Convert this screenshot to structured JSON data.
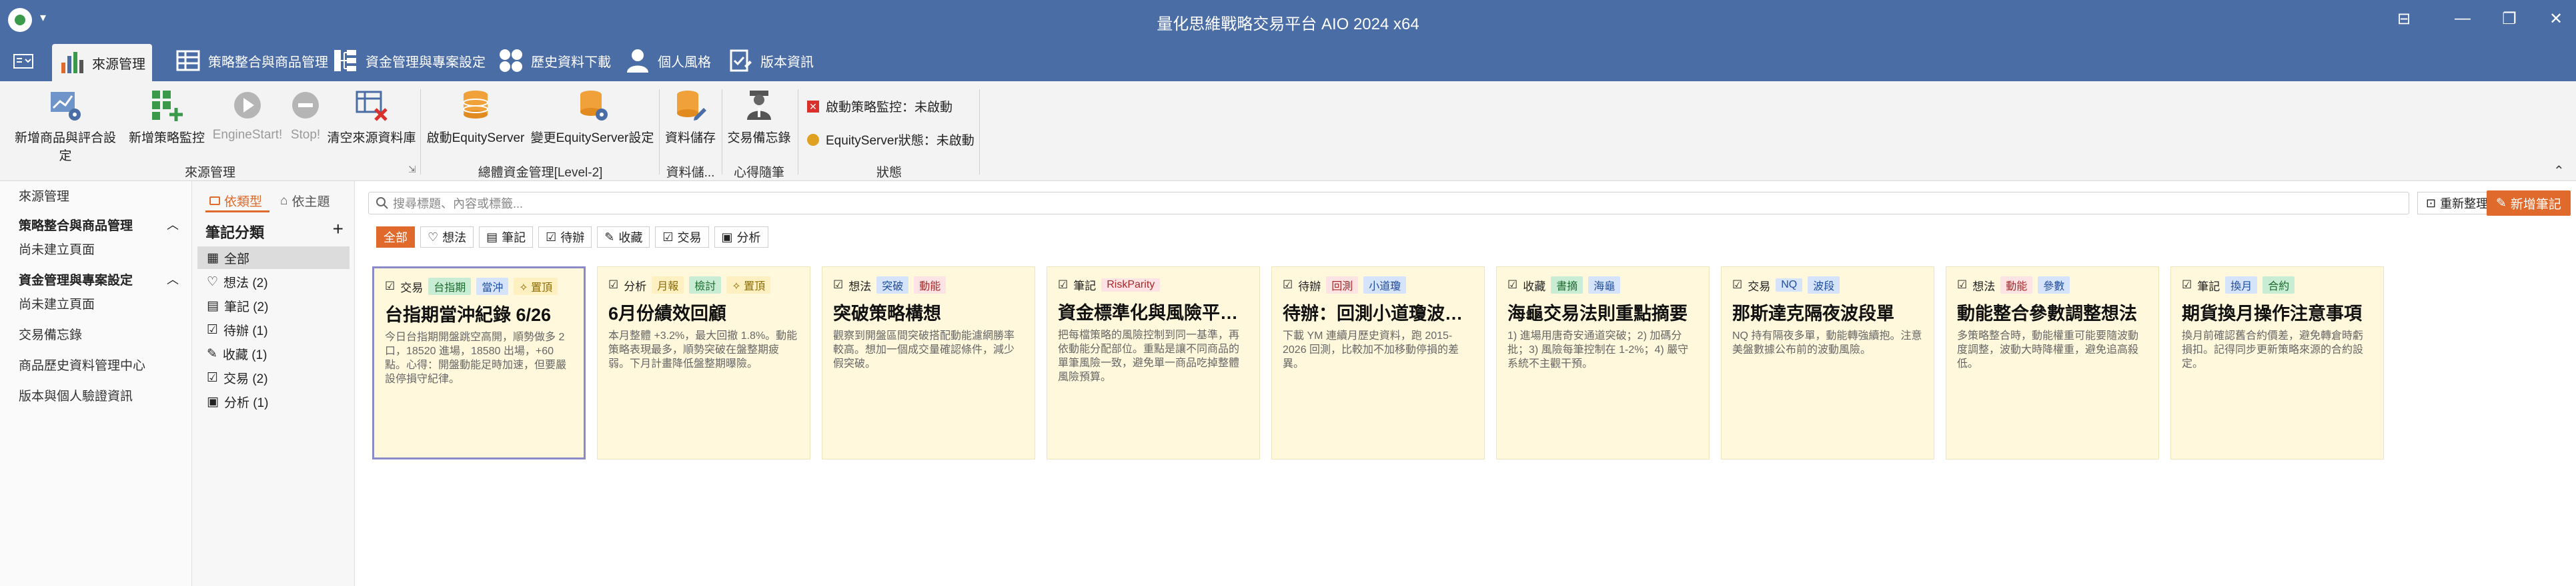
{
  "window": {
    "title": "量化思維戰略交易平台 AIO 2024 x64"
  },
  "tabs": [
    {
      "label": "來源管理",
      "icon": "bar-chart-icon"
    },
    {
      "label": "策略整合與商品管理",
      "icon": "grid-icon"
    },
    {
      "label": "資金管理與專案設定",
      "icon": "tree-icon"
    },
    {
      "label": "歷史資料下載",
      "icon": "dots-icon"
    },
    {
      "label": "個人風格",
      "icon": "person-icon"
    },
    {
      "label": "版本資訊",
      "icon": "clipboard-icon"
    }
  ],
  "ribbon": {
    "buttons": [
      {
        "label": "新增商品與評合設定",
        "icon": "gear-chart-icon"
      },
      {
        "label": "新增策略監控",
        "icon": "grid-add-icon"
      },
      {
        "label": "EngineStart!",
        "icon": "play-icon"
      },
      {
        "label": "Stop!",
        "icon": "minus-icon"
      },
      {
        "label": "清空來源資料庫",
        "icon": "clear-grid-icon"
      },
      {
        "label": "啟動EquityServer",
        "icon": "database-icon"
      },
      {
        "label": "變更EquityServer設定",
        "icon": "database-gear-icon"
      },
      {
        "label": "資料儲存",
        "icon": "database-edit-icon"
      },
      {
        "label": "交易備忘錄",
        "icon": "trader-icon"
      }
    ],
    "groups": [
      "來源管理",
      "總體資金管理[Level-2]",
      "資料儲...",
      "心得隨筆",
      "狀態"
    ],
    "status": {
      "monitor": "啟動策略監控：未啟動",
      "equity": "EquityServer狀態：未啟動"
    }
  },
  "leftnav": {
    "top": "來源管理",
    "sections": [
      {
        "head": "策略整合與商品管理",
        "items": [
          "尚未建立頁面"
        ]
      },
      {
        "head": "資金管理與專案設定",
        "items": [
          "尚未建立頁面",
          "交易備忘錄",
          "商品歷史資料管理中心",
          "版本與個人驗證資訊"
        ]
      }
    ]
  },
  "catpanel": {
    "tab_type": "依類型",
    "tab_theme": "依主題",
    "title": "筆記分類",
    "add": "+",
    "items": [
      {
        "icon": "grid-icon",
        "label": "全部"
      },
      {
        "icon": "bulb-icon",
        "label": "想法 (2)"
      },
      {
        "icon": "note-icon",
        "label": "筆記 (2)"
      },
      {
        "icon": "check-icon",
        "label": "待辦 (1)"
      },
      {
        "icon": "pin-icon",
        "label": "收藏 (1)"
      },
      {
        "icon": "chart-icon",
        "label": "交易 (2)"
      },
      {
        "icon": "chart-bar-icon",
        "label": "分析 (1)"
      }
    ]
  },
  "main": {
    "search_placeholder": "搜尋標題、內容或標籤...",
    "refresh": "重新整理",
    "new_note": "新增筆記",
    "filters": [
      "全部",
      "想法",
      "筆記",
      "待辦",
      "收藏",
      "交易",
      "分析"
    ],
    "cards": [
      {
        "type": "交易",
        "tags": [
          {
            "t": "台指期",
            "c": 0
          },
          {
            "t": "當沖",
            "c": 1
          },
          {
            "t": "✧ 置頂",
            "c": 3
          }
        ],
        "title": "台指期當沖紀錄 6/26",
        "body": "今日台指期開盤跳空高開，順勢做多 2 口，18520 進場，18580 出場，+60 點。心得：開盤動能足時加速，但要嚴設停損守紀律。"
      },
      {
        "type": "分析",
        "tags": [
          {
            "t": "月報",
            "c": 3
          },
          {
            "t": "檢討",
            "c": 0
          },
          {
            "t": "✧ 置頂",
            "c": 3
          }
        ],
        "title": "6月份績效回顧",
        "body": "本月整體 +3.2%，最大回撤 1.8%。動能策略表現最多，順勢突破在盤整期疲弱。下月計畫降低盤整期曝險。"
      },
      {
        "type": "想法",
        "tags": [
          {
            "t": "突破",
            "c": 1
          },
          {
            "t": "動能",
            "c": 2
          }
        ],
        "title": "突破策略構想",
        "body": "觀察到開盤區間突破搭配動能濾網勝率較高。想加一個成交量確認條件，減少假突破。"
      },
      {
        "type": "筆記",
        "tags": [
          {
            "t": "RiskParity",
            "c": 2
          }
        ],
        "title": "資金標準化與風險平注...",
        "body": "把每檔策略的風險控制到同一基準，再依動能分配部位。重點是讓不同商品的單筆風險一致，避免單一商品吃掉整體風險預算。"
      },
      {
        "type": "待辦",
        "tags": [
          {
            "t": "回測",
            "c": 2
          },
          {
            "t": "小道瓊",
            "c": 1
          }
        ],
        "title": "待辦：回測小道瓊波段...",
        "body": "下載 YM 連續月歷史資料，跑 2015-2026 回測，比較加不加移動停損的差異。"
      },
      {
        "type": "收藏",
        "tags": [
          {
            "t": "書摘",
            "c": 0
          },
          {
            "t": "海龜",
            "c": 1
          }
        ],
        "title": "海龜交易法則重點摘要",
        "body": "1) 進場用唐奇安通道突破；2) 加碼分批；3) 風險每筆控制在 1-2%；4) 嚴守系統不主觀干預。"
      },
      {
        "type": "交易",
        "tags": [
          {
            "t": "NQ",
            "c": 1
          },
          {
            "t": "波段",
            "c": 1
          }
        ],
        "title": "那斯達克隔夜波段單",
        "body": "NQ 持有隔夜多單，動能轉強續抱。注意美盤數據公布前的波動風險。"
      },
      {
        "type": "想法",
        "tags": [
          {
            "t": "動能",
            "c": 2
          },
          {
            "t": "參數",
            "c": 1
          }
        ],
        "title": "動能整合參數調整想法",
        "body": "多策略整合時，動能權重可能要隨波動度調整，波動大時降權重，避免追高殺低。"
      },
      {
        "type": "筆記",
        "tags": [
          {
            "t": "換月",
            "c": 1
          },
          {
            "t": "合約",
            "c": 0
          }
        ],
        "title": "期貨換月操作注意事項",
        "body": "換月前確認舊合約價差，避免轉倉時虧損扣。記得同步更新策略來源的合約設定。"
      }
    ]
  }
}
